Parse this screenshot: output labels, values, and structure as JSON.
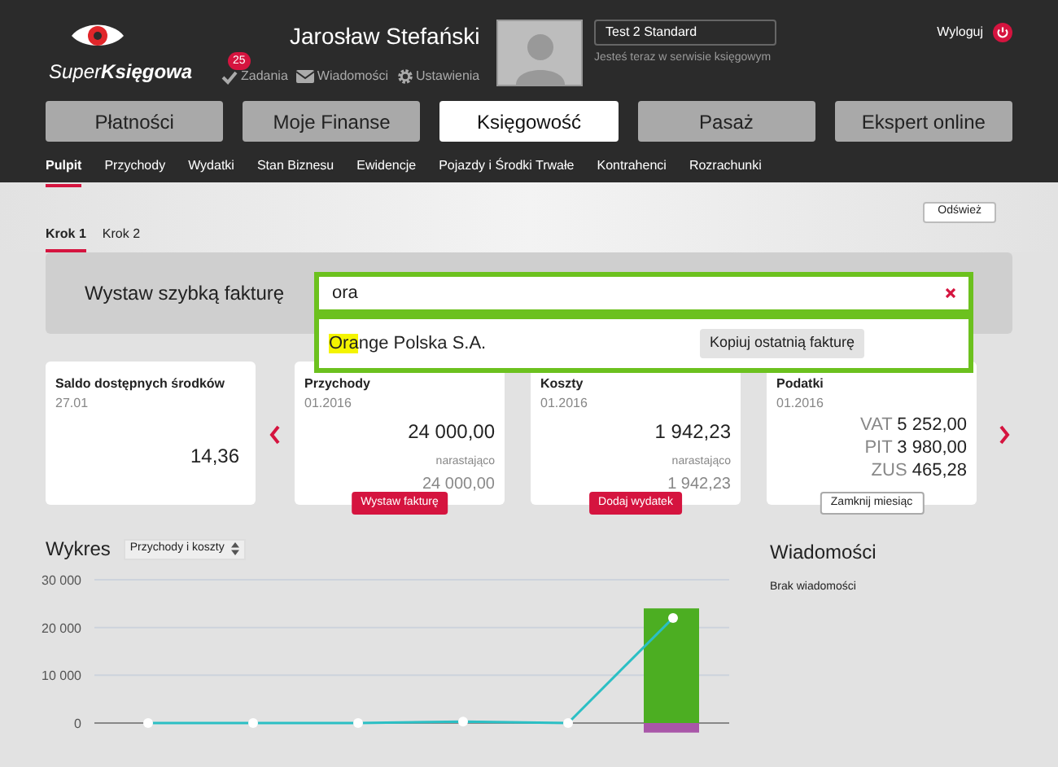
{
  "header": {
    "logo": {
      "part_1": "Super",
      "part_2": "Księgowa"
    },
    "user_name": "Jarosław Stefański",
    "links": [
      {
        "kind": "tasks",
        "label": "Zadania",
        "badge": "25"
      },
      {
        "kind": "messages",
        "label": "Wiadomości"
      },
      {
        "kind": "settings",
        "label": "Ustawienia"
      }
    ],
    "account_select": "Test 2 Standard",
    "account_note": "Jesteś teraz w serwisie księgowym",
    "logout": "Wyloguj"
  },
  "main_nav": [
    {
      "label": "Płatności",
      "selected": false
    },
    {
      "label": "Moje Finanse",
      "selected": false
    },
    {
      "label": "Księgowość",
      "selected": true
    },
    {
      "label": "Pasaż",
      "selected": false
    },
    {
      "label": "Ekspert online",
      "selected": false
    }
  ],
  "sub_nav": [
    {
      "label": "Pulpit",
      "selected": true
    },
    {
      "label": "Przychody",
      "selected": false
    },
    {
      "label": "Wydatki",
      "selected": false
    },
    {
      "label": "Stan Biznesu",
      "selected": false
    },
    {
      "label": "Ewidencje",
      "selected": false
    },
    {
      "label": "Pojazdy i Środki Trwałe",
      "selected": false
    },
    {
      "label": "Kontrahenci",
      "selected": false
    },
    {
      "label": "Rozrachunki",
      "selected": false
    }
  ],
  "refresh_button": "Odśwież",
  "steps": [
    {
      "label": "Krok 1",
      "selected": true
    },
    {
      "label": "Krok 2",
      "selected": false
    }
  ],
  "quick_invoice": {
    "label": "Wystaw szybką fakturę",
    "value": "ora",
    "suggestion": {
      "match": "Ora",
      "rest": "nge Polska S.A.",
      "button": "Kopiuj ostatnią fakturę"
    }
  },
  "cards": [
    {
      "kind": "balance",
      "title": "Saldo dostępnych środków",
      "date": "27.01",
      "amount": "14,36"
    },
    {
      "kind": "summary",
      "title": "Przychody",
      "date": "01.2016",
      "amount": "24 000,00",
      "cumulative_label": "narastająco",
      "cumulative": "24 000,00",
      "button": "Wystaw fakturę"
    },
    {
      "kind": "summary",
      "title": "Koszty",
      "date": "01.2016",
      "amount": "1 942,23",
      "cumulative_label": "narastająco",
      "cumulative": "1 942,23",
      "button": "Dodaj wydatek"
    },
    {
      "kind": "taxes",
      "title": "Podatki",
      "date": "01.2016",
      "taxes": [
        {
          "label": "VAT",
          "amount": "5 252,00"
        },
        {
          "label": "PIT",
          "amount": "3 980,00"
        },
        {
          "label": "ZUS",
          "amount": "465,28"
        }
      ],
      "button": "Zamknij miesiąc"
    }
  ],
  "chart_section": {
    "title": "Wykres",
    "select": "Przychody i koszty",
    "chart_data": {
      "type": "bar",
      "ylim": [
        -2000,
        30000
      ],
      "yticks": [
        {
          "value": 0,
          "label": "0"
        },
        {
          "value": 10000,
          "label": "10 000"
        },
        {
          "value": 20000,
          "label": "20 000"
        },
        {
          "value": 30000,
          "label": "30 000"
        }
      ],
      "series": [
        {
          "type": "bar",
          "color": "#4cae22",
          "values": [
            0,
            0,
            0,
            0,
            0,
            24000
          ]
        },
        {
          "type": "bar",
          "color": "#a956a8",
          "values": [
            0,
            0,
            0,
            0,
            0,
            -2000
          ]
        },
        {
          "type": "line",
          "marker": true,
          "color": "#2bbfc4",
          "values": [
            0,
            0,
            0,
            300,
            0,
            22000
          ]
        }
      ]
    }
  },
  "messages": {
    "title": "Wiadomości",
    "empty": "Brak wiadomości"
  }
}
